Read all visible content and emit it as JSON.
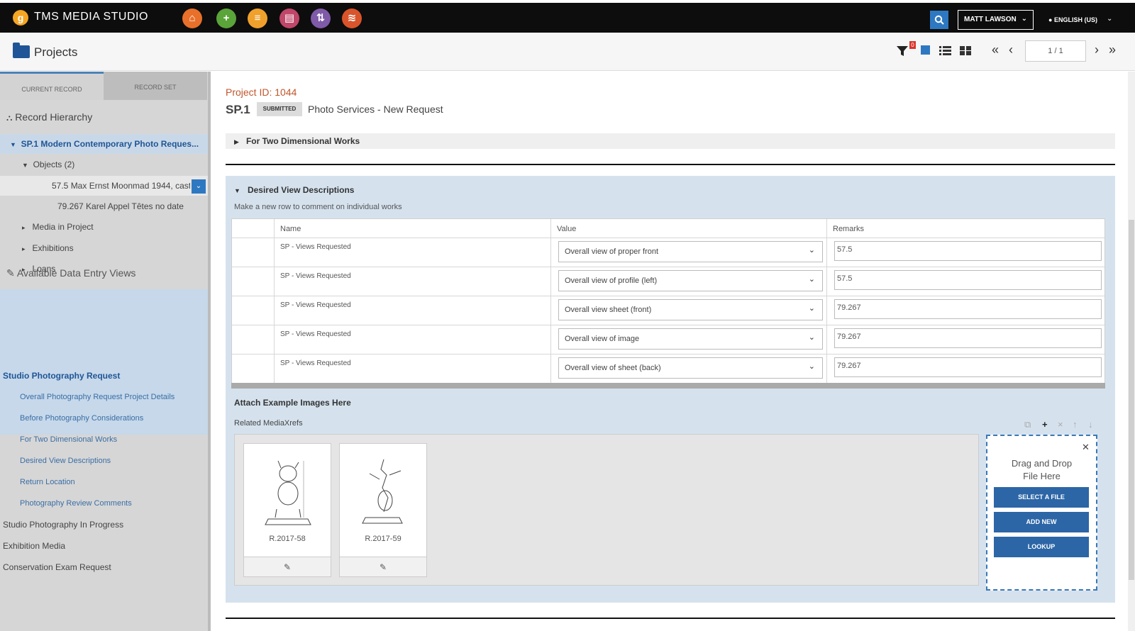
{
  "app": {
    "title": "TMS MEDIA STUDIO",
    "logo_letter": "g"
  },
  "topbar": {
    "icons": [
      {
        "name": "home-icon",
        "color": "#e8702a",
        "glyph": "⌂"
      },
      {
        "name": "add-icon",
        "color": "#5aa43a",
        "glyph": "+"
      },
      {
        "name": "document-icon",
        "color": "#f0a12c",
        "glyph": "≡"
      },
      {
        "name": "media-icon",
        "color": "#c0466a",
        "glyph": "▤"
      },
      {
        "name": "transfer-icon",
        "color": "#7e5aa8",
        "glyph": "⇅"
      },
      {
        "name": "layers-icon",
        "color": "#d9542b",
        "glyph": "≋"
      }
    ],
    "user": "MATT LAWSON",
    "language": "ENGLISH (US)"
  },
  "header": {
    "page_title": "Projects",
    "filter_count": "0",
    "pager": "1 / 1"
  },
  "left": {
    "tabs": [
      "CURRENT RECORD",
      "RECORD SET"
    ],
    "record_hierarchy": "Record Hierarchy",
    "tree": {
      "root": "SP.1 Modern Contemporary Photo Reques...",
      "objects": "Objects (2)",
      "object_1": "57.5 Max Ernst Moonmad 1944, cast",
      "object_2": "79.267 Karel Appel Têtes no date",
      "media": "Media in Project",
      "exhibitions": "Exhibitions",
      "loans": "Loans"
    },
    "available_views": "Available Data Entry Views",
    "active_view": "Studio Photography Request",
    "view_sections": [
      "Overall Photography Request Project Details",
      "Before Photography Considerations",
      "For Two Dimensional Works",
      "Desired View Descriptions",
      "Return Location",
      "Photography Review Comments"
    ],
    "other_views": [
      "Studio Photography In Progress",
      "Exhibition Media",
      "Conservation Exam Request"
    ]
  },
  "record": {
    "project_id": "Project ID: 1044",
    "code": "SP.1",
    "status": "SUBMITTED",
    "name": "Photo Services - New Request"
  },
  "sections": {
    "two_dimensional": "For Two Dimensional Works",
    "desired_views": "Desired View Descriptions",
    "hint": "Make a new row to comment on individual works"
  },
  "grid": {
    "columns": [
      "Name",
      "Value",
      "Remarks"
    ],
    "rows": [
      {
        "name": "SP - Views Requested",
        "value": "Overall view of proper front",
        "remarks": "57.5"
      },
      {
        "name": "SP - Views Requested",
        "value": "Overall view of profile (left)",
        "remarks": "57.5"
      },
      {
        "name": "SP - Views Requested",
        "value": "Overall view sheet (front)",
        "remarks": "79.267"
      },
      {
        "name": "SP - Views Requested",
        "value": "Overall view of image",
        "remarks": "79.267"
      },
      {
        "name": "SP - Views Requested",
        "value": "Overall view of sheet (back)",
        "remarks": "79.267"
      }
    ]
  },
  "attach": {
    "title": "Attach Example Images Here",
    "related": "Related MediaXrefs",
    "media": [
      {
        "label": "R.2017-58"
      },
      {
        "label": "R.2017-59"
      }
    ],
    "drop_text_1": "Drag and Drop",
    "drop_text_2": "File Here",
    "select_file": "SELECT A FILE",
    "add_new": "ADD NEW",
    "lookup": "LOOKUP"
  }
}
